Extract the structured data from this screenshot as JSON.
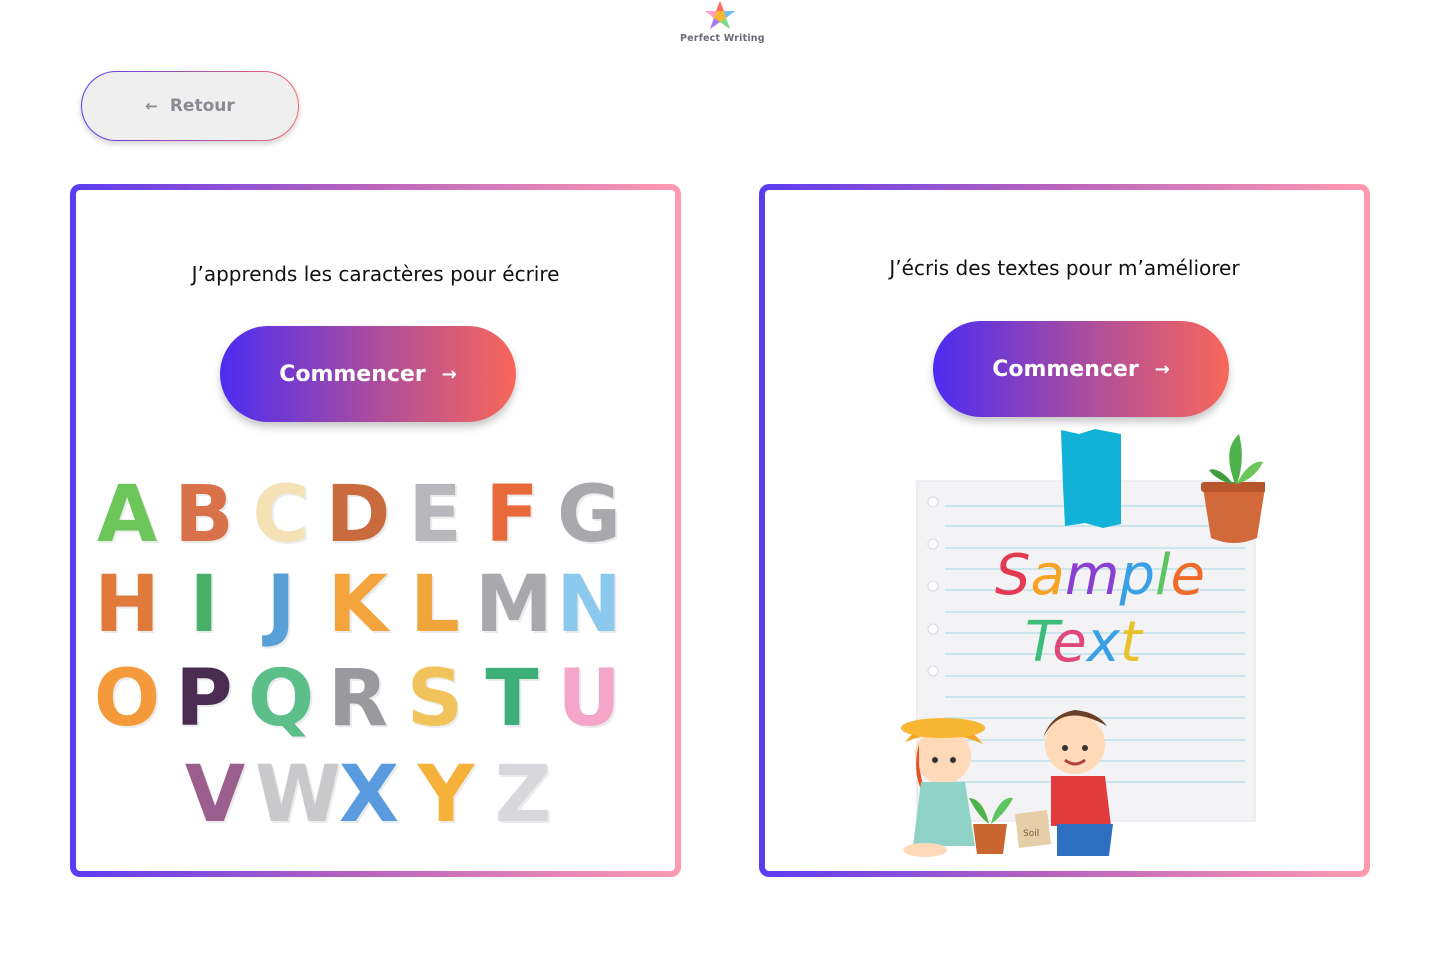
{
  "brand": {
    "name": "Perfect Writing",
    "logo_icon": "star-icon"
  },
  "back_button": {
    "label": "Retour",
    "icon": "arrow-left-icon"
  },
  "cards": [
    {
      "title": "J’apprends  les caractères pour écrire",
      "button_label": "Commencer",
      "button_icon": "arrow-right-icon",
      "illustration": "animal-alphabet",
      "letters": [
        "A",
        "B",
        "C",
        "D",
        "E",
        "F",
        "G",
        "H",
        "I",
        "J",
        "K",
        "L",
        "M",
        "N",
        "O",
        "P",
        "Q",
        "R",
        "S",
        "T",
        "U",
        "V",
        "W",
        "X",
        "Y",
        "Z"
      ]
    },
    {
      "title": "J’écris des textes pour m’améliorer",
      "button_label": "Commencer",
      "button_icon": "arrow-right-icon",
      "illustration": "notebook-with-children",
      "sample_text": [
        "Sample",
        "Text"
      ],
      "pot_label": "Soil"
    }
  ],
  "colors": {
    "gradient_start": "#4c2cf2",
    "gradient_end": "#f8675a",
    "border_end": "#ff9bb0"
  }
}
